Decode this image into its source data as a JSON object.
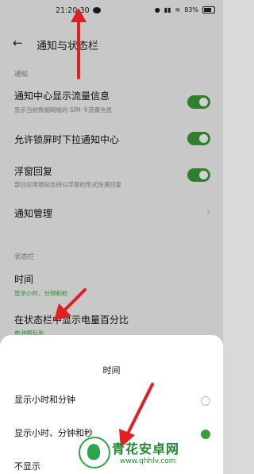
{
  "status_bar": {
    "time": "21:20:30",
    "battery": "83%"
  },
  "header": {
    "title": "通知与状态栏"
  },
  "sections": {
    "notifications": "通知",
    "status_bar": "状态栏"
  },
  "rows": [
    {
      "title": "通知中心显示流量信息",
      "subtitle": "显示当前数据网络的 SIM 卡流量信息"
    },
    {
      "title": "允许锁屏时下拉通知中心"
    },
    {
      "title": "浮窗回复",
      "subtitle": "部分应用通知支持以浮窗的形式快速回复"
    },
    {
      "title": "通知管理"
    },
    {
      "title": "时间",
      "subtitle": "显示小时、分钟和秒"
    },
    {
      "title": "在状态栏中显示电量百分比",
      "subtitle": "电池图标外"
    }
  ],
  "sheet": {
    "title": "时间",
    "options": [
      "显示小时和分钟",
      "显示小时、分钟和秒",
      "不显示"
    ]
  },
  "watermark": {
    "name": "青花安卓网",
    "url": "www.qhhlv.com"
  }
}
